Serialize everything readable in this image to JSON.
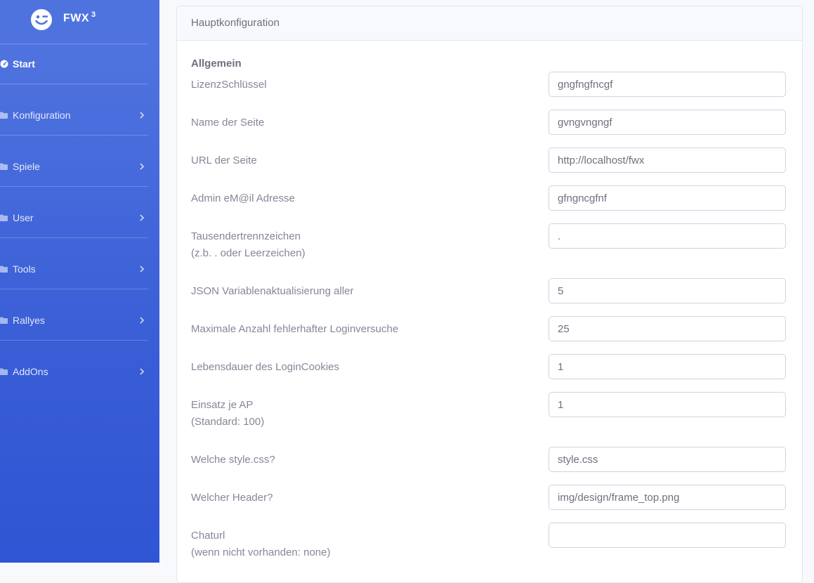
{
  "brand": {
    "name": "FWX",
    "superscript": "3"
  },
  "sidebar": {
    "items": [
      {
        "label": "Start",
        "icon": "dashboard-icon"
      },
      {
        "label": "Konfiguration",
        "icon": "folder-icon"
      },
      {
        "label": "Spiele",
        "icon": "folder-icon"
      },
      {
        "label": "User",
        "icon": "folder-icon"
      },
      {
        "label": "Tools",
        "icon": "folder-icon"
      },
      {
        "label": "Rallyes",
        "icon": "folder-icon"
      },
      {
        "label": "AddOns",
        "icon": "folder-icon"
      }
    ]
  },
  "card": {
    "title": "Hauptkonfiguration",
    "section": "Allgemein",
    "rows": [
      {
        "label": "LizenzSchlüssel",
        "value": "gngfngfncgf"
      },
      {
        "label": "Name der Seite",
        "value": "gvngvngngf"
      },
      {
        "label": "URL der Seite",
        "value": "http://localhost/fwx"
      },
      {
        "label": "Admin eM@il Adresse",
        "value": "gfngncgfnf"
      },
      {
        "label": "Tausendertrennzeichen",
        "label2": "(z.b. . oder Leerzeichen)",
        "value": "."
      },
      {
        "label": "JSON Variablenaktualisierung aller",
        "value": "5"
      },
      {
        "label": "Maximale Anzahl fehlerhafter Loginversuche",
        "value": "25"
      },
      {
        "label": "Lebensdauer des LoginCookies",
        "value": "1"
      },
      {
        "label": "Einsatz je AP",
        "label2": "(Standard: 100)",
        "value": "1"
      },
      {
        "label": "Welche style.css?",
        "value": "style.css"
      },
      {
        "label": "Welcher Header?",
        "value": "img/design/frame_top.png"
      },
      {
        "label": "Chaturl",
        "label2": "(wenn nicht vorhanden: none)",
        "value": ""
      }
    ]
  },
  "colors": {
    "sidebar": "#4e73df",
    "text": "#858796"
  }
}
